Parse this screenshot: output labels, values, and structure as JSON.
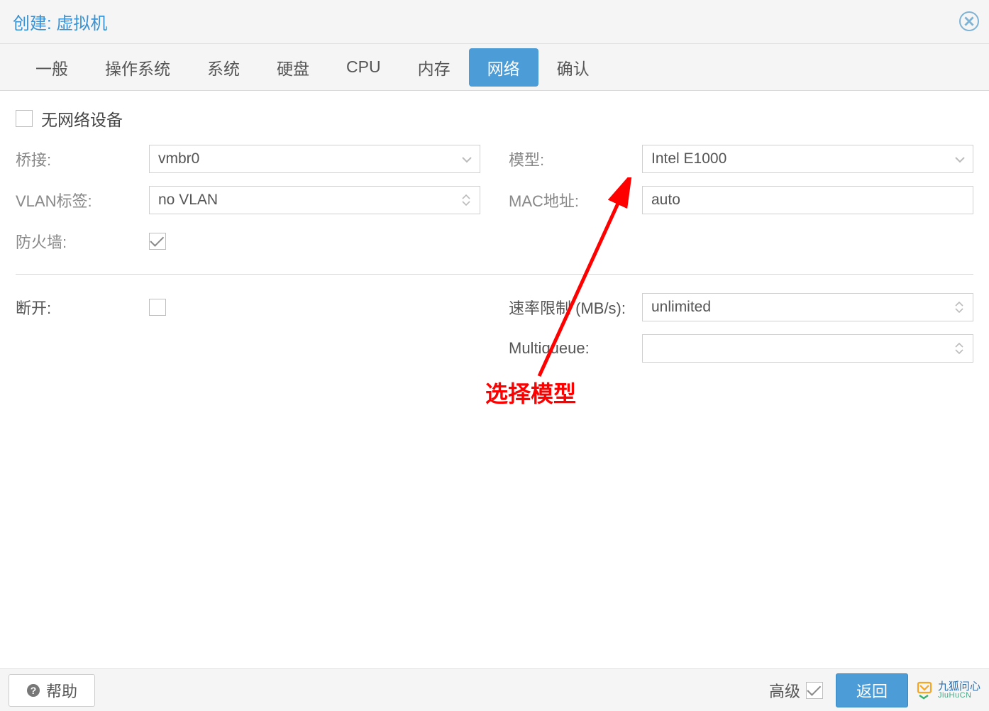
{
  "header": {
    "title": "创建: 虚拟机"
  },
  "tabs": {
    "general": "一般",
    "os": "操作系统",
    "system": "系统",
    "disk": "硬盘",
    "cpu": "CPU",
    "memory": "内存",
    "network": "网络",
    "confirm": "确认",
    "active": "network"
  },
  "no_net": {
    "label": "无网络设备",
    "checked": false
  },
  "left": {
    "bridge": {
      "label": "桥接:",
      "value": "vmbr0"
    },
    "vlan": {
      "label": "VLAN标签:",
      "value": "no VLAN"
    },
    "firewall": {
      "label": "防火墙:",
      "checked": true
    },
    "disconnect": {
      "label": "断开:",
      "checked": false
    }
  },
  "right": {
    "model": {
      "label": "模型:",
      "value": "Intel E1000"
    },
    "mac": {
      "label": "MAC地址:",
      "value": "auto"
    },
    "rate": {
      "label": "速率限制 (MB/s):",
      "value": "unlimited"
    },
    "multiqueue": {
      "label": "Multiqueue:",
      "value": ""
    }
  },
  "annotation": "选择模型",
  "footer": {
    "help": "帮助",
    "advanced": "高级",
    "advanced_checked": true,
    "back": "返回",
    "brand_top": "九狐问心",
    "brand_sub": "JiuHuCN"
  }
}
